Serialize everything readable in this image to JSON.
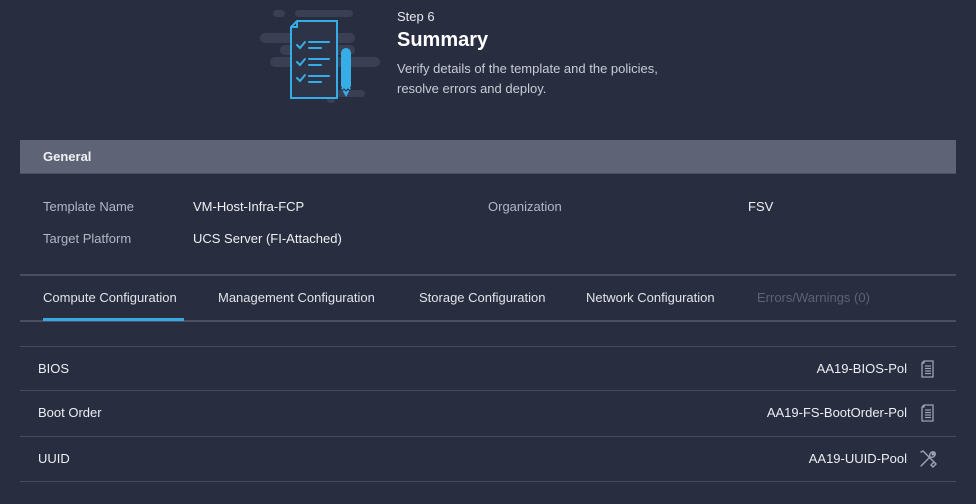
{
  "hero": {
    "illustration": "checklist-document-with-pencil-icon",
    "step_label": "Step 6",
    "title": "Summary",
    "description": "Verify details of the template and the policies, resolve errors and deploy."
  },
  "general": {
    "header": "General",
    "fields": [
      {
        "label": "Template Name",
        "value": "VM-Host-Infra-FCP"
      },
      {
        "label": "Target Platform",
        "value": "UCS Server (FI-Attached)"
      },
      {
        "label": "Organization",
        "value": "FSV"
      }
    ]
  },
  "tabs": [
    {
      "label": "Compute Configuration",
      "active": true,
      "disabled": false
    },
    {
      "label": "Management Configuration",
      "active": false,
      "disabled": false
    },
    {
      "label": "Storage Configuration",
      "active": false,
      "disabled": false
    },
    {
      "label": "Network Configuration",
      "active": false,
      "disabled": false
    },
    {
      "label": "Errors/Warnings (0)",
      "active": false,
      "disabled": true
    }
  ],
  "rows": [
    {
      "label": "BIOS",
      "value": "AA19-BIOS-Pol",
      "icon": "document-icon"
    },
    {
      "label": "Boot Order",
      "value": "AA19-FS-BootOrder-Pol",
      "icon": "document-icon"
    },
    {
      "label": "UUID",
      "value": "AA19-UUID-Pool",
      "icon": "tools-icon"
    }
  ],
  "colors": {
    "background": "#282d40",
    "section_header": "#5e6376",
    "accent": "#3aa8e0",
    "disabled_text": "#5d6274"
  }
}
